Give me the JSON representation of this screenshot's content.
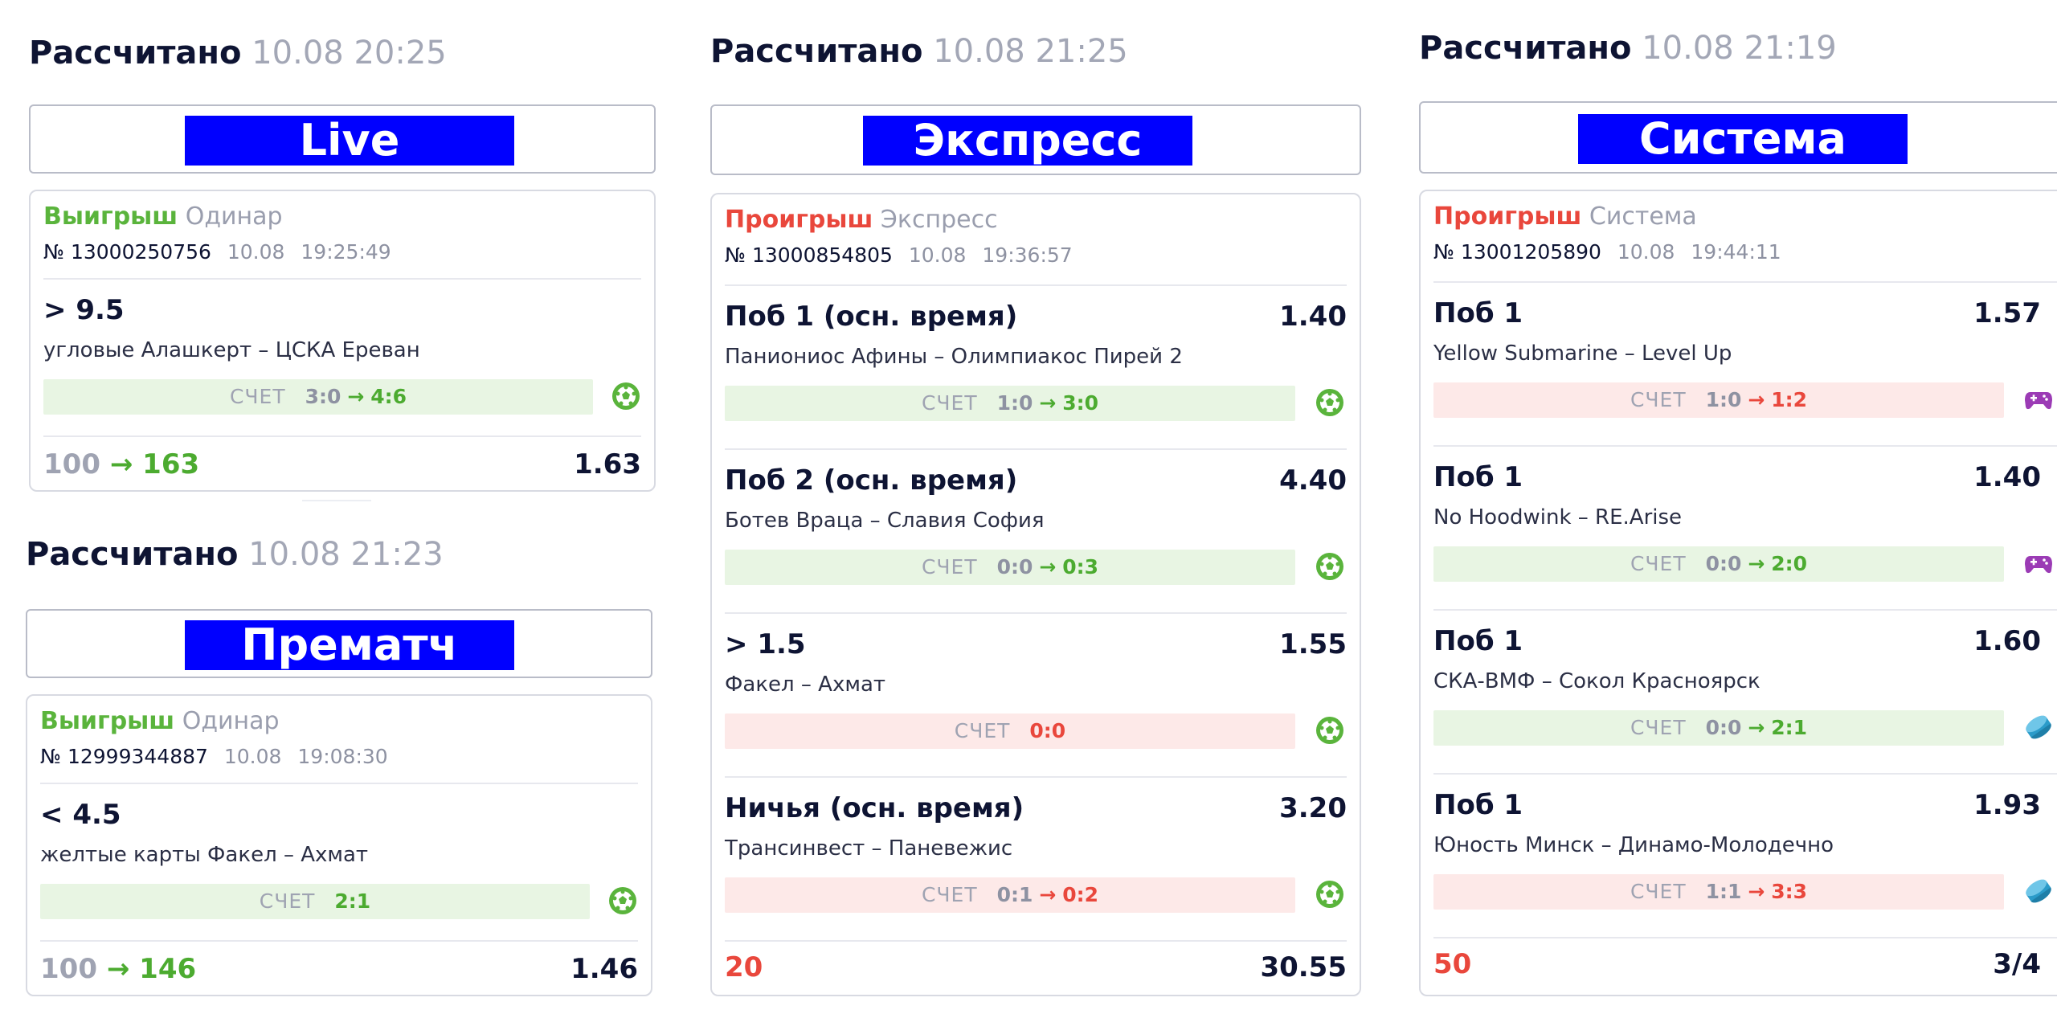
{
  "colors": {
    "banner": "#0000ff",
    "win": "#5ab43c",
    "loss": "#e9473c",
    "header": "#0e1433",
    "muted": "#a3a7b6"
  },
  "icons": {
    "football": "football-icon",
    "esports": "gamepad-icon",
    "hockey": "hockey-puck-icon",
    "arrow": "arrow-right-icon"
  },
  "live": {
    "header": {
      "label": "Рассчитано",
      "datetime": "10.08 20:25"
    },
    "banner": "Live",
    "card": {
      "status": "Выигрыш",
      "type": "Одинар",
      "number": "№ 13000250756",
      "date": "10.08",
      "time": "19:25:49",
      "events": [
        {
          "pick": "> 9.5",
          "odds": "",
          "teams": "угловые Алашкерт – ЦСКА Ереван",
          "score_word": "СЧЕТ",
          "score_from": "3:0",
          "arrow": "→",
          "score_to": "4:6"
        }
      ],
      "stake": "100",
      "arrow": "→",
      "payout": "163",
      "total_odds": "1.63"
    }
  },
  "prematch": {
    "header": {
      "label": "Рассчитано",
      "datetime": "10.08 21:23"
    },
    "banner": "Прематч",
    "card": {
      "status": "Выигрыш",
      "type": "Одинар",
      "number": "№ 12999344887",
      "date": "10.08",
      "time": "19:08:30",
      "events": [
        {
          "pick": "< 4.5",
          "odds": "",
          "teams": "желтые карты Факел – Ахмат",
          "score_word": "СЧЕТ",
          "score_from": "",
          "arrow": "",
          "score_to": "2:1"
        }
      ],
      "stake": "100",
      "arrow": "→",
      "payout": "146",
      "total_odds": "1.46"
    }
  },
  "express": {
    "header": {
      "label": "Рассчитано",
      "datetime": "10.08 21:25"
    },
    "banner": "Экспресс",
    "card": {
      "status": "Проигрыш",
      "type": "Экспресс",
      "number": "№ 13000854805",
      "date": "10.08",
      "time": "19:36:57",
      "events": [
        {
          "pick": "Поб 1 (осн. время)",
          "odds": "1.40",
          "teams": "Паниониос Афины – Олимпиакос Пирей 2",
          "score_word": "СЧЕТ",
          "score_from": "1:0",
          "arrow": "→",
          "score_to": "3:0"
        },
        {
          "pick": "Поб 2 (осн. время)",
          "odds": "4.40",
          "teams": "Ботев Враца – Славия София",
          "score_word": "СЧЕТ",
          "score_from": "0:0",
          "arrow": "→",
          "score_to": "0:3"
        },
        {
          "pick": "> 1.5",
          "odds": "1.55",
          "teams": "Факел – Ахмат",
          "score_word": "СЧЕТ",
          "score_from": "",
          "arrow": "",
          "score_to": "0:0"
        },
        {
          "pick": "Ничья (осн. время)",
          "odds": "3.20",
          "teams": "Трансинвест – Паневежис",
          "score_word": "СЧЕТ",
          "score_from": "0:1",
          "arrow": "→",
          "score_to": "0:2"
        }
      ],
      "stake": "20",
      "total_odds": "30.55"
    }
  },
  "system": {
    "header": {
      "label": "Рассчитано",
      "datetime": "10.08 21:19"
    },
    "banner": "Система",
    "card": {
      "status": "Проигрыш",
      "type": "Система",
      "number": "№ 13001205890",
      "date": "10.08",
      "time": "19:44:11",
      "events": [
        {
          "pick": "Поб 1",
          "odds": "1.57",
          "teams": "Yellow Submarine – Level Up",
          "score_word": "СЧЕТ",
          "score_from": "1:0",
          "arrow": "→",
          "score_to": "1:2"
        },
        {
          "pick": "Поб 1",
          "odds": "1.40",
          "teams": "No Hoodwink – RE.Arise",
          "score_word": "СЧЕТ",
          "score_from": "0:0",
          "arrow": "→",
          "score_to": "2:0"
        },
        {
          "pick": "Поб 1",
          "odds": "1.60",
          "teams": "СКА-ВМФ – Сокол Красноярск",
          "score_word": "СЧЕТ",
          "score_from": "0:0",
          "arrow": "→",
          "score_to": "2:1"
        },
        {
          "pick": "Поб 1",
          "odds": "1.93",
          "teams": "Юность Минск – Динамо-Молодечно",
          "score_word": "СЧЕТ",
          "score_from": "1:1",
          "arrow": "→",
          "score_to": "3:3"
        }
      ],
      "stake": "50",
      "total_odds": "3/4"
    }
  }
}
